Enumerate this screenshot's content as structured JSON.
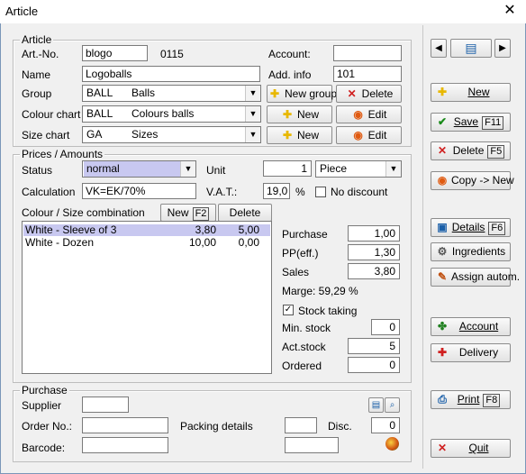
{
  "window": {
    "title": "Article",
    "close_glyph": "✕"
  },
  "article": {
    "group_title": "Article",
    "art_no_label": "Art.-No.",
    "art_no_value": "blogo",
    "art_no_code": "0115",
    "account_label": "Account:",
    "account_value": "",
    "name_label": "Name",
    "name_value": "Logoballs",
    "add_info_label": "Add. info",
    "add_info_value": "101",
    "group_label": "Group",
    "group_code": "BALL",
    "group_name": "Balls",
    "colour_label": "Colour chart",
    "colour_code": "BALL",
    "colour_name": "Colours balls",
    "size_label": "Size chart",
    "size_code": "GA",
    "size_name": "Sizes",
    "new_group_btn": "New group",
    "delete_btn": "Delete",
    "new_btn": "New",
    "edit_btn": "Edit"
  },
  "prices": {
    "group_title": "Prices / Amounts",
    "status_label": "Status",
    "status_value": "normal",
    "unit_label": "Unit",
    "unit_value": "1",
    "unit_type": "Piece",
    "calc_label": "Calculation",
    "calc_value": "VK=EK/70%",
    "vat_label": "V.A.T.:",
    "vat_value": "19,0",
    "vat_unit": "%",
    "no_discount_label": "No discount",
    "combo_label": "Colour / Size combination",
    "combo_new_btn": "New",
    "combo_new_key": "F2",
    "combo_delete_btn": "Delete",
    "combo_rows": [
      {
        "name": "White - Sleeve of 3",
        "v1": "3,80",
        "v2": "5,00",
        "selected": true
      },
      {
        "name": "White - Dozen",
        "v1": "10,00",
        "v2": "0,00",
        "selected": false
      }
    ],
    "purchase_label": "Purchase",
    "purchase_value": "1,00",
    "pp_label": "PP(eff.)",
    "pp_value": "1,30",
    "sales_label": "Sales",
    "sales_value": "3,80",
    "marge_text": "Marge: 59,29 %",
    "stock_taking_label": "Stock taking",
    "stock_taking_checked": true,
    "min_stock_label": "Min. stock",
    "min_stock_value": "0",
    "act_stock_label": "Act.stock",
    "act_stock_value": "5",
    "ordered_label": "Ordered",
    "ordered_value": "0"
  },
  "purchase": {
    "group_title": "Purchase",
    "supplier_label": "Supplier",
    "supplier_value": "",
    "order_no_label": "Order No.:",
    "order_no_value": "",
    "packing_label": "Packing details",
    "packing_value": "",
    "disc_label": "Disc.",
    "disc_value": "0",
    "barcode_label": "Barcode:",
    "barcode_value": "",
    "barcode_extra": ""
  },
  "sidebar": {
    "nav_prev": "◀",
    "nav_next": "▶",
    "new_label": "New",
    "save_label": "Save",
    "save_key": "F11",
    "delete_label": "Delete",
    "delete_key": "F5",
    "copy_label": "Copy -> New",
    "details_label": "Details",
    "details_key": "F6",
    "ingredients_label": "Ingredients",
    "assign_label": "Assign autom.",
    "account_label": "Account",
    "delivery_label": "Delivery",
    "print_label": "Print",
    "print_key": "F8",
    "quit_label": "Quit"
  },
  "colors": {
    "accent_selection": "#c8c8f0",
    "delete_red": "#d02020",
    "save_green": "#1a8a1a",
    "plus_yellow": "#e8c020"
  }
}
